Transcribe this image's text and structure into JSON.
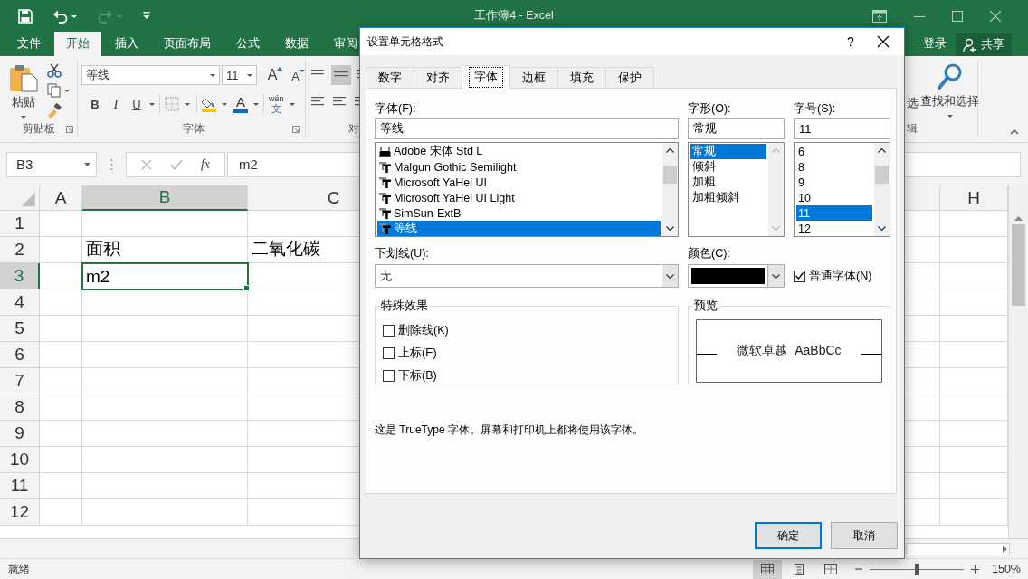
{
  "window": {
    "title": "工作簿4 - Excel"
  },
  "quick_access": [
    {
      "kind": "save",
      "disabled": false
    },
    {
      "kind": "undo",
      "disabled": false
    },
    {
      "kind": "redo",
      "disabled": true
    },
    {
      "kind": "customize",
      "disabled": false
    }
  ],
  "ribbon_tabs": [
    {
      "label": "文件",
      "selected": false
    },
    {
      "label": "开始",
      "selected": true
    },
    {
      "label": "插入",
      "selected": false
    },
    {
      "label": "页面布局",
      "selected": false
    },
    {
      "label": "公式",
      "selected": false
    },
    {
      "label": "数据",
      "selected": false
    },
    {
      "label": "审阅",
      "selected": false
    }
  ],
  "account": {
    "sign_in": "登录",
    "share": "共享"
  },
  "ribbon": {
    "clipboard": {
      "paste": "粘贴",
      "label": "剪贴板"
    },
    "font": {
      "name": "等线",
      "size": "11",
      "grow": "A",
      "shrink": "A",
      "bold": "B",
      "italic": "I",
      "underline": "U",
      "font_color": "A",
      "phonetic_top": "wén",
      "phonetic_bottom": "文",
      "label": "字体"
    },
    "alignment": {
      "label": "对"
    },
    "editing": {
      "partial_label": "选",
      "find_select": "查找和选择",
      "label": "辑"
    }
  },
  "formula_bar": {
    "name_box": "B3",
    "function": "fx",
    "value": "m2"
  },
  "sheet": {
    "columns": [
      {
        "label": "A",
        "selected": false
      },
      {
        "label": "B",
        "selected": true
      },
      {
        "label": "C",
        "selected": false
      },
      {
        "label": "H",
        "selected": false
      }
    ],
    "rows": [
      {
        "label": "1",
        "selected": false
      },
      {
        "label": "2",
        "selected": false,
        "column_b": "面积",
        "column_c": "二氧化碳"
      },
      {
        "label": "3",
        "selected": true,
        "column_b": "m2"
      },
      {
        "label": "4",
        "selected": false
      },
      {
        "label": "5",
        "selected": false
      },
      {
        "label": "6",
        "selected": false
      },
      {
        "label": "7",
        "selected": false
      },
      {
        "label": "8",
        "selected": false
      },
      {
        "label": "9",
        "selected": false
      },
      {
        "label": "10",
        "selected": false
      },
      {
        "label": "11",
        "selected": false
      },
      {
        "label": "12",
        "selected": false
      }
    ]
  },
  "status_bar": {
    "text": "就绪",
    "views": [
      {
        "kind": "normal",
        "selected": true
      },
      {
        "kind": "page_layout",
        "selected": false
      },
      {
        "kind": "page_break",
        "selected": false
      }
    ],
    "zoom_slider": {
      "level": 0.5
    },
    "zoom": "150%"
  },
  "dialog": {
    "title": "设置单元格格式",
    "help": "?",
    "tabs": [
      {
        "label": "数字",
        "selected": false
      },
      {
        "label": "对齐",
        "selected": false
      },
      {
        "label": "字体",
        "selected": true
      },
      {
        "label": "边框",
        "selected": false
      },
      {
        "label": "填充",
        "selected": false
      },
      {
        "label": "保护",
        "selected": false
      }
    ],
    "font": {
      "label": "字体(F):",
      "value": "等线",
      "items": [
        {
          "text": "Adobe 宋体 Std L",
          "kind": "printer",
          "selected": false
        },
        {
          "text": "Malgun Gothic Semilight",
          "kind": "truetype",
          "selected": false
        },
        {
          "text": "Microsoft YaHei UI",
          "kind": "truetype",
          "selected": false
        },
        {
          "text": "Microsoft YaHei UI Light",
          "kind": "truetype",
          "selected": false
        },
        {
          "text": "SimSun-ExtB",
          "kind": "truetype",
          "selected": false
        },
        {
          "text": "等线",
          "kind": "truetype",
          "selected": true
        }
      ]
    },
    "style": {
      "label": "字形(O):",
      "value": "常规",
      "items": [
        {
          "text": "常规",
          "selected": true
        },
        {
          "text": "倾斜",
          "selected": false
        },
        {
          "text": "加粗",
          "selected": false
        },
        {
          "text": "加粗倾斜",
          "selected": false
        }
      ]
    },
    "size": {
      "label": "字号(S):",
      "value": "11",
      "items": [
        {
          "text": "6",
          "selected": false
        },
        {
          "text": "8",
          "selected": false
        },
        {
          "text": "9",
          "selected": false
        },
        {
          "text": "10",
          "selected": false
        },
        {
          "text": "11",
          "selected": true
        },
        {
          "text": "12",
          "selected": false
        }
      ]
    },
    "underline": {
      "label": "下划线(U):",
      "value": "无"
    },
    "color": {
      "label": "颜色(C):",
      "color": "#000000"
    },
    "normal_font": {
      "label": "普通字体(N)",
      "checked": true
    },
    "effects": {
      "title": "特殊效果",
      "items": [
        {
          "label": "删除线(K)",
          "checked": false
        },
        {
          "label": "上标(E)",
          "checked": false
        },
        {
          "label": "下标(B)",
          "checked": false
        }
      ]
    },
    "preview": {
      "title": "预览",
      "text": "微软卓越  AaBbCc"
    },
    "note": "这是 TrueType 字体。屏幕和打印机上都将使用该字体。",
    "buttons": [
      {
        "label": "确定",
        "kind": "default"
      },
      {
        "label": "取消",
        "kind": "normal"
      }
    ]
  }
}
